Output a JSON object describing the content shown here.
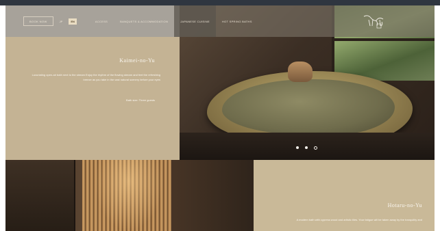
{
  "header": {
    "book_label": "BOOK NOW",
    "languages": [
      "JP",
      "EN"
    ],
    "active_language": "EN",
    "nav": [
      "ACCESS",
      "BANQUETS & ACCOMMODATION",
      "JAPANESE CUISINE",
      "HOT SPRING BATHS"
    ],
    "active_nav": "HOT SPRING BATHS"
  },
  "section1": {
    "title": "Kaimei-no-Yu",
    "description": "Luxuriating open-air bath next to the stream Enjoy the rhythm of the flowing stream and feel the refreshing breeze as you take in the vast natural scenery before your eyes",
    "caption": "Bath size: Three guests",
    "slides": 3,
    "active_slide": 0
  },
  "section2": {
    "title": "Hotaru-no-Yu",
    "description": "A modern bath with cypress wood and artistic tiles. Your fatigue will be taken away by the tranquility and"
  }
}
